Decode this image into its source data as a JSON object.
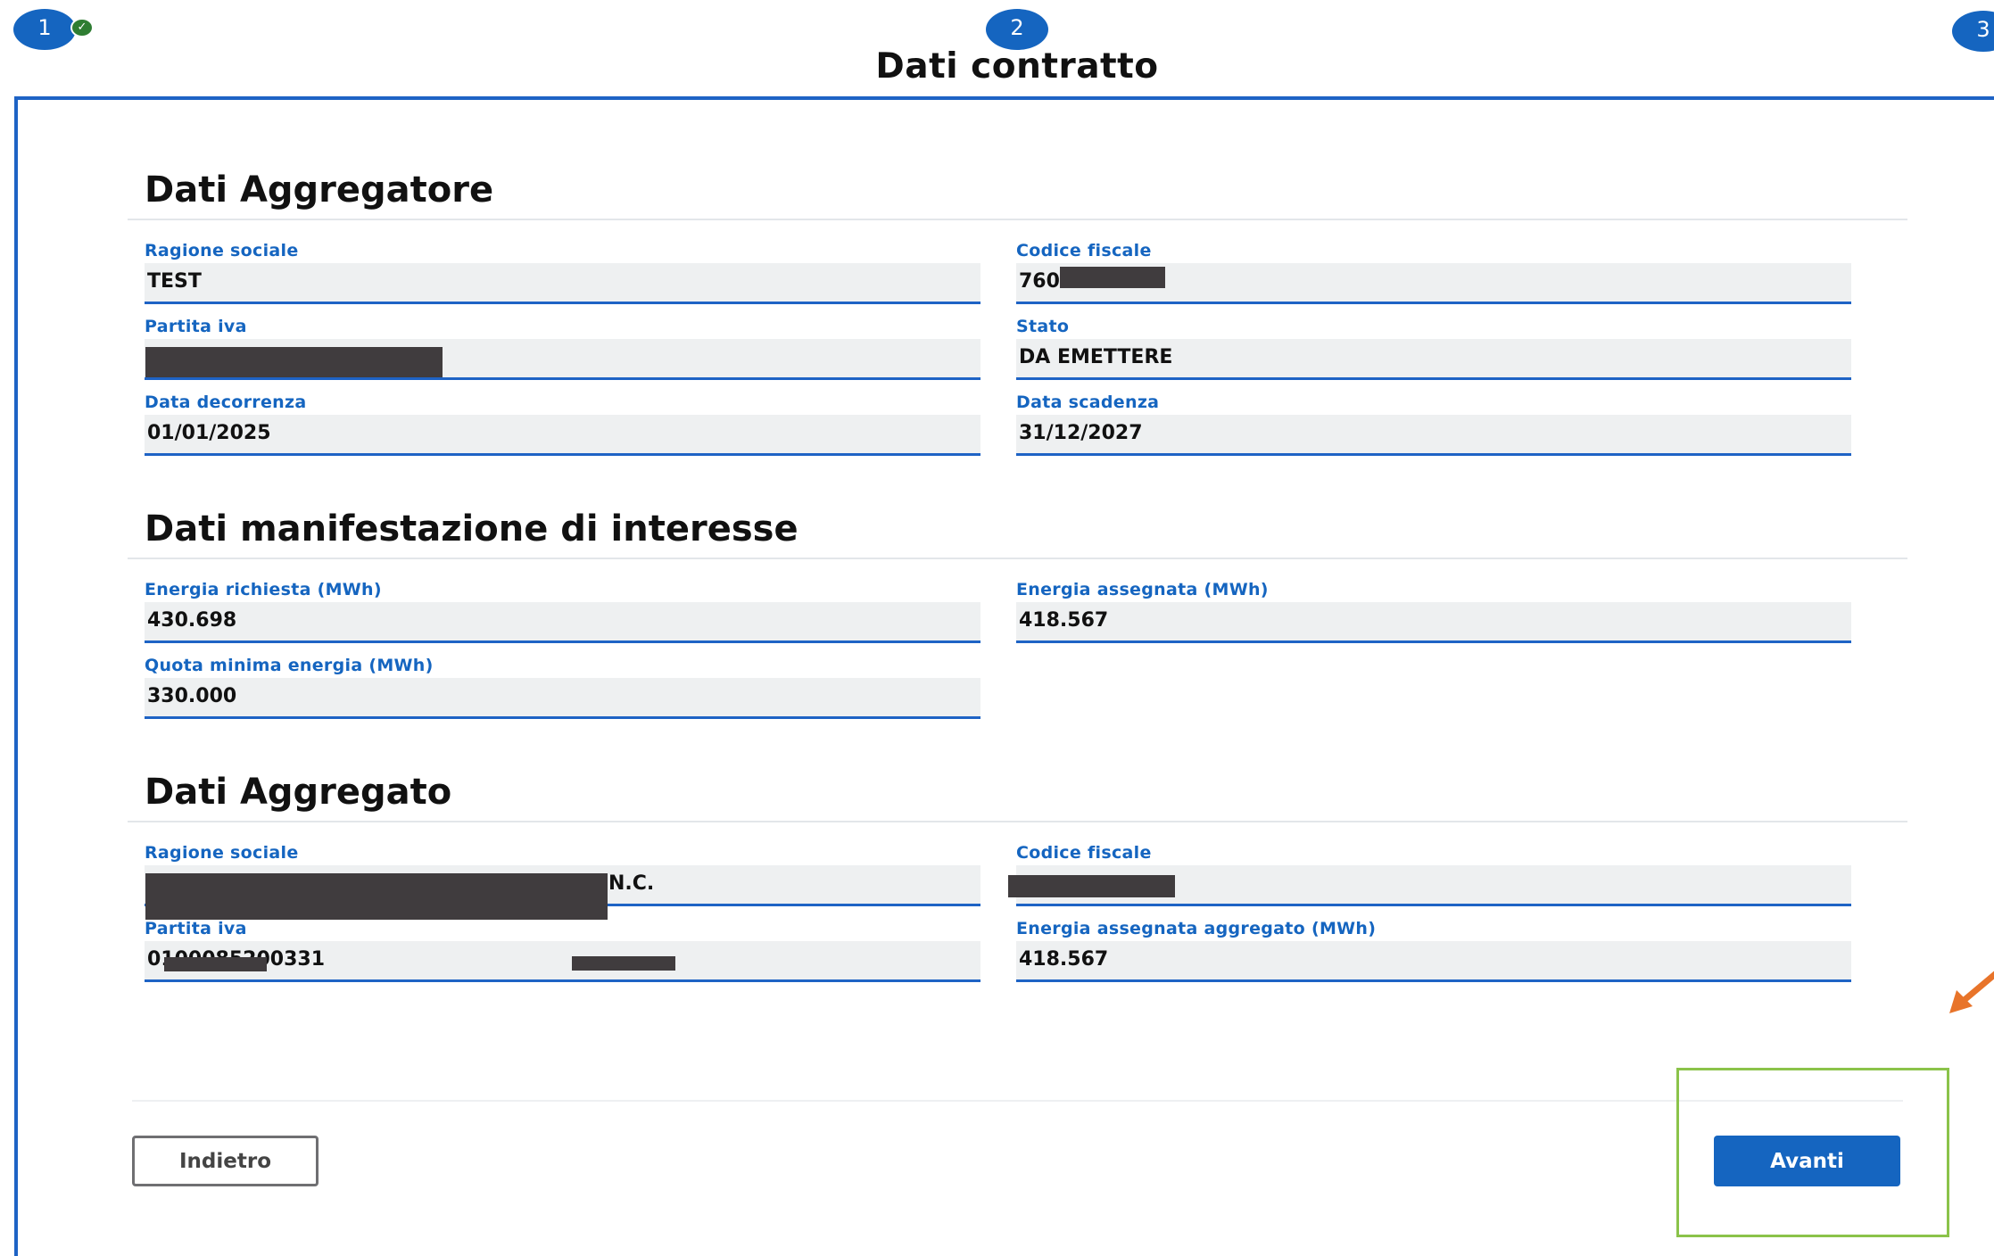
{
  "stepper": {
    "steps": [
      {
        "number": "1",
        "completed": true
      },
      {
        "number": "2",
        "completed": false
      },
      {
        "number": "3",
        "completed": false
      }
    ],
    "current_title": "Dati contratto",
    "check_glyph": "✓"
  },
  "sections": {
    "aggregatore": {
      "title": "Dati Aggregatore",
      "ragione_sociale": {
        "label": "Ragione sociale",
        "value": "TEST"
      },
      "codice_fiscale": {
        "label": "Codice fiscale",
        "value": "760"
      },
      "partita_iva": {
        "label": "Partita iva",
        "value": ""
      },
      "stato": {
        "label": "Stato",
        "value": "DA EMETTERE"
      },
      "data_decorrenza": {
        "label": "Data decorrenza",
        "value": "01/01/2025"
      },
      "data_scadenza": {
        "label": "Data scadenza",
        "value": "31/12/2027"
      }
    },
    "manifestazione": {
      "title": "Dati manifestazione di interesse",
      "energia_richiesta": {
        "label": "Energia richiesta (MWh)",
        "value": "430.698"
      },
      "energia_assegnata": {
        "label": "Energia assegnata (MWh)",
        "value": "418.567"
      },
      "quota_minima": {
        "label": "Quota minima energia (MWh)",
        "value": "330.000"
      }
    },
    "aggregato": {
      "title": "Dati Aggregato",
      "ragione_sociale": {
        "label": "Ragione sociale",
        "value": "N.C."
      },
      "codice_fiscale": {
        "label": "Codice fiscale",
        "value": ""
      },
      "partita_iva": {
        "label": "Partita iva",
        "value": "0100085200331"
      },
      "energia_assegnata_aggregato": {
        "label": "Energia assegnata aggregato (MWh)",
        "value": "418.567"
      }
    }
  },
  "footer": {
    "back_label": "Indietro",
    "next_label": "Avanti"
  },
  "colors": {
    "accent": "#1565c0",
    "field_bg": "#eef0f1",
    "redaction": "#403c3e",
    "highlight": "#8bc34a",
    "arrow": "#e8742a"
  }
}
